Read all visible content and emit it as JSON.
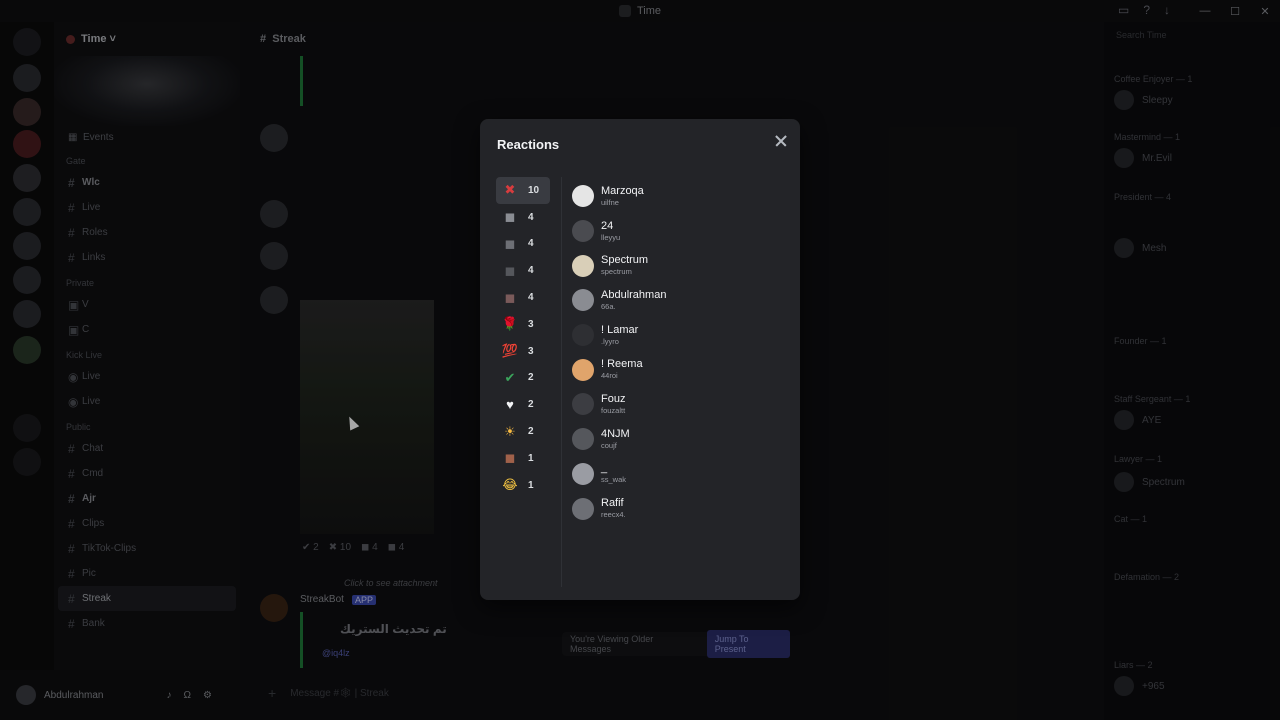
{
  "window": {
    "title": "Time"
  },
  "server": {
    "name": "Time"
  },
  "sidebar": {
    "events_label": "Events",
    "channels": [
      {
        "cat": "Gate",
        "items": [
          {
            "label": "Wlc",
            "bold": true
          },
          {
            "label": "Live"
          },
          {
            "label": "Roles"
          },
          {
            "label": "Links"
          }
        ]
      },
      {
        "cat": "Private",
        "items": [
          {
            "label": "V"
          },
          {
            "label": "C"
          }
        ]
      },
      {
        "cat": "Kick Live",
        "items": [
          {
            "label": "Live"
          },
          {
            "label": "Live"
          }
        ]
      },
      {
        "cat": "Public",
        "items": [
          {
            "label": "Chat"
          },
          {
            "label": "Cmd"
          },
          {
            "label": "Ajr",
            "bold": true
          },
          {
            "label": "Clips"
          },
          {
            "label": "TikTok-Clips"
          },
          {
            "label": "Pic"
          },
          {
            "label": "Streak",
            "active": true
          },
          {
            "label": "Bank"
          }
        ]
      }
    ]
  },
  "user": {
    "name": "Abdulrahman"
  },
  "chat": {
    "channel_name": "Streak",
    "streakbot_name": "StreakBot",
    "app_badge": "APP",
    "embed_title": "تم تحديث الستريك",
    "mention": "@iq4lz",
    "click_attachment": "Click to see attachment",
    "older_label": "You're Viewing Older Messages",
    "jump_label": "Jump To Present",
    "composer_placeholder": "Message #🕸 | Streak"
  },
  "members": {
    "search_placeholder": "Search Time",
    "groups": [
      {
        "cat": "Coffee Enjoyer — 1",
        "name": "Sleepy"
      },
      {
        "cat": "Mastermind — 1",
        "name": "Mr.Evil"
      },
      {
        "cat": "President — 4",
        "name": "Mesh"
      },
      {
        "cat": "Founder — 1",
        "name": ""
      },
      {
        "cat": "Staff Sergeant — 1",
        "name": "AYE"
      },
      {
        "cat": "Lawyer — 1",
        "name": "Spectrum"
      },
      {
        "cat": "Cat — 1",
        "name": ""
      },
      {
        "cat": "Defamation — 2",
        "name": ""
      },
      {
        "cat": "Liars — 2",
        "name": "+965"
      }
    ]
  },
  "modal": {
    "title": "Reactions",
    "emojis": [
      {
        "glyph": "✖",
        "color": "#d83c3e",
        "count": "10",
        "selected": true
      },
      {
        "glyph": "◼",
        "color": "#8a8d93",
        "count": "4"
      },
      {
        "glyph": "◼",
        "color": "#6d6f75",
        "count": "4"
      },
      {
        "glyph": "◼",
        "color": "#55575c",
        "count": "4"
      },
      {
        "glyph": "◼",
        "color": "#7a5a5a",
        "count": "4"
      },
      {
        "glyph": "🌹",
        "color": "#c0392b",
        "count": "3"
      },
      {
        "glyph": "💯",
        "color": "#e74c3c",
        "count": "3"
      },
      {
        "glyph": "✔",
        "color": "#3ba55c",
        "count": "2"
      },
      {
        "glyph": "♥",
        "color": "#f2f3f5",
        "count": "2"
      },
      {
        "glyph": "☀",
        "color": "#f5b942",
        "count": "2"
      },
      {
        "glyph": "◼",
        "color": "#a0614a",
        "count": "1"
      },
      {
        "glyph": "😂",
        "color": "#f5c542",
        "count": "1"
      }
    ],
    "users": [
      {
        "name": "Marzoqa",
        "handle": "uilfne",
        "av": "#e5e5e5"
      },
      {
        "name": "24",
        "handle": "lleyyu",
        "av": "#4a4b50"
      },
      {
        "name": "Spectrum",
        "handle": "spectrum",
        "av": "#d9cfb8"
      },
      {
        "name": "Abdulrahman",
        "handle": "66a.",
        "av": "#8a8c92"
      },
      {
        "name": "! Lamar",
        "handle": ".lyyro",
        "av": "#2e2f33"
      },
      {
        "name": "! Reema",
        "handle": "44roi",
        "av": "#e0a46b"
      },
      {
        "name": "Fouz",
        "handle": "fouzaltt",
        "av": "#3c3d42"
      },
      {
        "name": "4NJM",
        "handle": "coujf",
        "av": "#55575c"
      },
      {
        "name": "_",
        "handle": "ss_wak",
        "av": "#9a9ca3"
      },
      {
        "name": "Rafif",
        "handle": "reecx4.",
        "av": "#6d6f75"
      }
    ]
  }
}
